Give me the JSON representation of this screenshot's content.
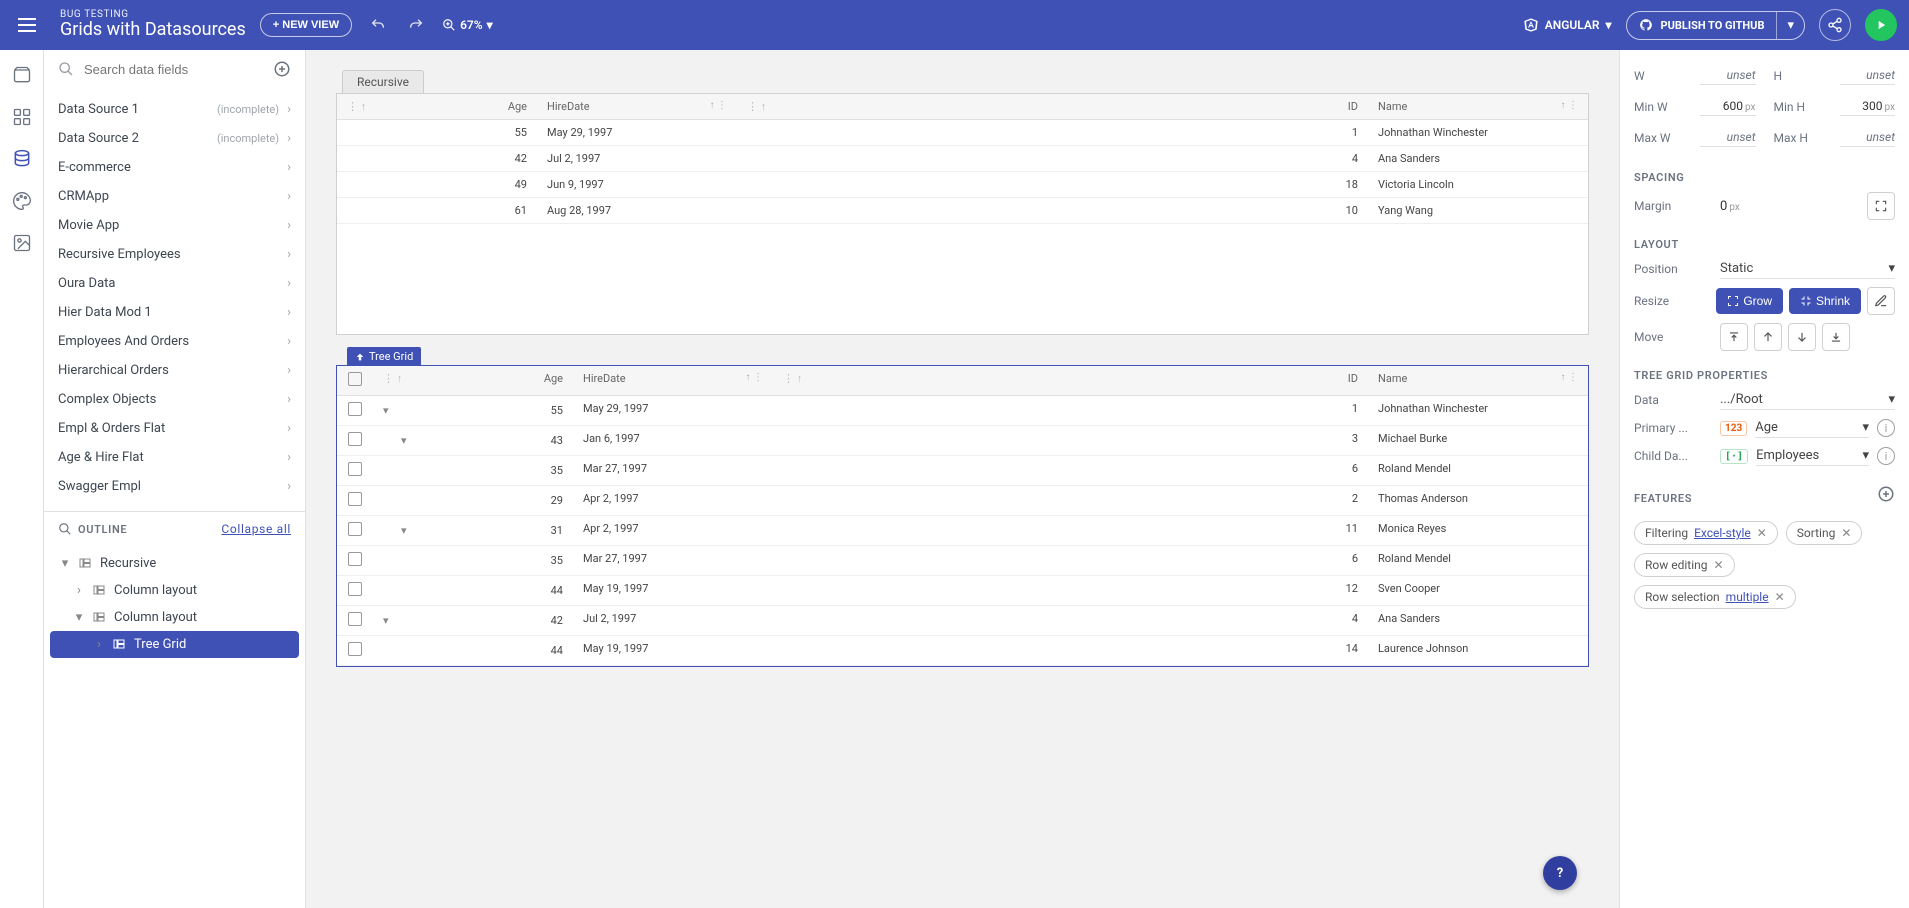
{
  "header": {
    "subtitle": "BUG TESTING",
    "title": "Grids with Datasources",
    "new_view": "+ NEW VIEW",
    "zoom": "67%",
    "framework": "ANGULAR",
    "publish": "PUBLISH TO GITHUB"
  },
  "left": {
    "search_placeholder": "Search data fields",
    "sources": [
      {
        "name": "Data Source 1",
        "tag": "(incomplete)"
      },
      {
        "name": "Data Source 2",
        "tag": "(incomplete)"
      },
      {
        "name": "E-commerce"
      },
      {
        "name": "CRMApp"
      },
      {
        "name": "Movie App"
      },
      {
        "name": "Recursive Employees"
      },
      {
        "name": "Oura Data"
      },
      {
        "name": "Hier Data Mod 1"
      },
      {
        "name": "Employees And Orders"
      },
      {
        "name": "Hierarchical Orders"
      },
      {
        "name": "Complex Objects"
      },
      {
        "name": "Empl & Orders Flat"
      },
      {
        "name": "Age & Hire Flat"
      },
      {
        "name": "Swagger Empl"
      }
    ],
    "outline_label": "OUTLINE",
    "collapse": "Collapse all",
    "outline": [
      {
        "label": "Recursive",
        "lvl": 0,
        "expand": "down"
      },
      {
        "label": "Column layout",
        "lvl": 1,
        "expand": "right"
      },
      {
        "label": "Column layout",
        "lvl": 1,
        "expand": "down"
      },
      {
        "label": "Tree Grid",
        "lvl": 2,
        "expand": "right",
        "active": true
      }
    ]
  },
  "canvas": {
    "tab": "Recursive",
    "sel_label": "Tree Grid",
    "cols": [
      "Age",
      "HireDate",
      "ID",
      "Name"
    ],
    "grid1": [
      {
        "age": "55",
        "hire": "May 29, 1997",
        "id": "1",
        "name": "Johnathan Winchester"
      },
      {
        "age": "42",
        "hire": "Jul 2, 1997",
        "id": "4",
        "name": "Ana Sanders"
      },
      {
        "age": "49",
        "hire": "Jun 9, 1997",
        "id": "18",
        "name": "Victoria Lincoln"
      },
      {
        "age": "61",
        "hire": "Aug 28, 1997",
        "id": "10",
        "name": "Yang Wang"
      }
    ],
    "grid2": [
      {
        "exp": "v",
        "indent": 0,
        "age": "55",
        "hire": "May 29, 1997",
        "id": "1",
        "name": "Johnathan Winchester"
      },
      {
        "exp": "v",
        "indent": 1,
        "age": "43",
        "hire": "Jan 6, 1997",
        "id": "3",
        "name": "Michael Burke"
      },
      {
        "exp": "",
        "indent": 2,
        "age": "35",
        "hire": "Mar 27, 1997",
        "id": "6",
        "name": "Roland Mendel"
      },
      {
        "exp": "",
        "indent": 2,
        "age": "29",
        "hire": "Apr 2, 1997",
        "id": "2",
        "name": "Thomas Anderson"
      },
      {
        "exp": "v",
        "indent": 1,
        "age": "31",
        "hire": "Apr 2, 1997",
        "id": "11",
        "name": "Monica Reyes"
      },
      {
        "exp": "",
        "indent": 2,
        "age": "35",
        "hire": "Mar 27, 1997",
        "id": "6",
        "name": "Roland Mendel"
      },
      {
        "exp": "",
        "indent": 2,
        "age": "44",
        "hire": "May 19, 1997",
        "id": "12",
        "name": "Sven Cooper"
      },
      {
        "exp": "v",
        "indent": 0,
        "age": "42",
        "hire": "Jul 2, 1997",
        "id": "4",
        "name": "Ana Sanders"
      },
      {
        "exp": "",
        "indent": 1,
        "age": "44",
        "hire": "May 19, 1997",
        "id": "14",
        "name": "Laurence Johnson"
      }
    ]
  },
  "right": {
    "w": "unset",
    "h": "unset",
    "minw": "600",
    "minh": "300",
    "maxw": "unset",
    "maxh": "unset",
    "labels": {
      "w": "W",
      "h": "H",
      "minw": "Min W",
      "minh": "Min H",
      "maxw": "Max W",
      "maxh": "Max H",
      "px": "px"
    },
    "spacing": {
      "title": "SPACING",
      "margin_label": "Margin",
      "margin": "0"
    },
    "layout": {
      "title": "LAYOUT",
      "position_label": "Position",
      "position": "Static",
      "resize_label": "Resize",
      "grow": "Grow",
      "shrink": "Shrink",
      "move_label": "Move"
    },
    "tg": {
      "title": "TREE GRID PROPERTIES",
      "data_label": "Data",
      "data": ".../Root",
      "pk_label": "Primary ...",
      "pk": "Age",
      "cd_label": "Child Da...",
      "cd": "Employees"
    },
    "features": {
      "title": "FEATURES",
      "items": [
        {
          "label": "Filtering",
          "link": "Excel-style",
          "x": true
        },
        {
          "label": "Sorting",
          "x": true
        },
        {
          "label": "Row editing",
          "x": true
        },
        {
          "label": "Row selection",
          "link": "multiple",
          "x": true
        }
      ]
    }
  }
}
